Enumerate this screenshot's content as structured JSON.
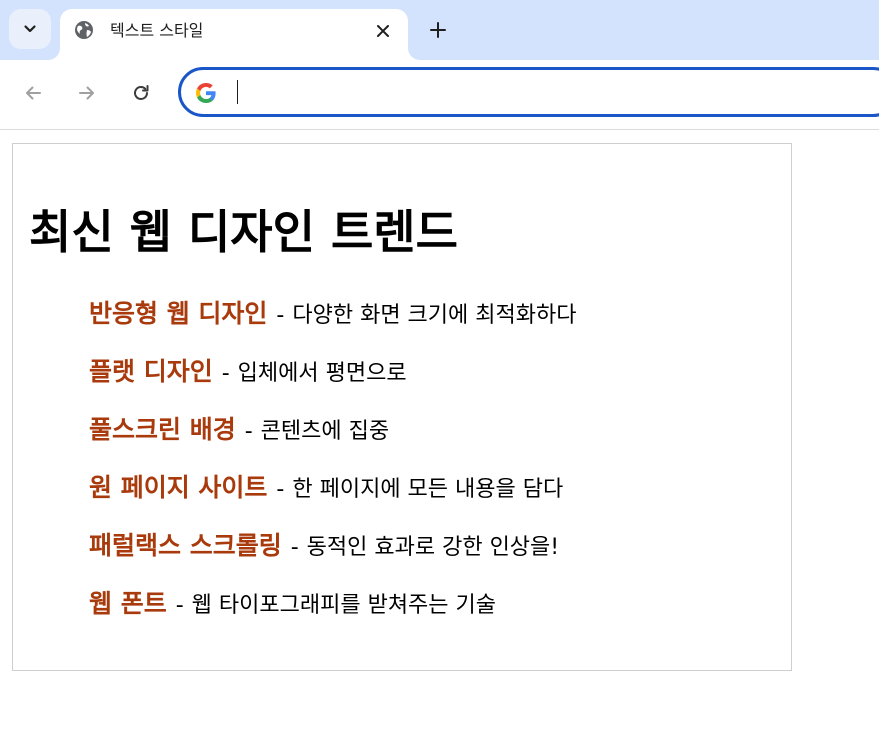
{
  "browser": {
    "tab_title": "텍스트 스타일",
    "address_value": "",
    "accent_color": "#1a56c8",
    "tabstrip_color": "#d3e3fd"
  },
  "page": {
    "heading": "최신 웹 디자인 트렌드",
    "title_color": "#a83a0c",
    "separator": "-",
    "items": [
      {
        "title": "반응형 웹 디자인",
        "description": "다양한 화면 크기에 최적화하다"
      },
      {
        "title": "플랫 디자인",
        "description": "입체에서 평면으로"
      },
      {
        "title": "풀스크린 배경",
        "description": "콘텐츠에 집중"
      },
      {
        "title": "원 페이지 사이트",
        "description": "한 페이지에 모든 내용을 담다"
      },
      {
        "title": "패럴랙스 스크롤링",
        "description": "동적인 효과로 강한 인상을!"
      },
      {
        "title": "웹 폰트",
        "description": "웹 타이포그래피를 받쳐주는 기술"
      }
    ]
  }
}
